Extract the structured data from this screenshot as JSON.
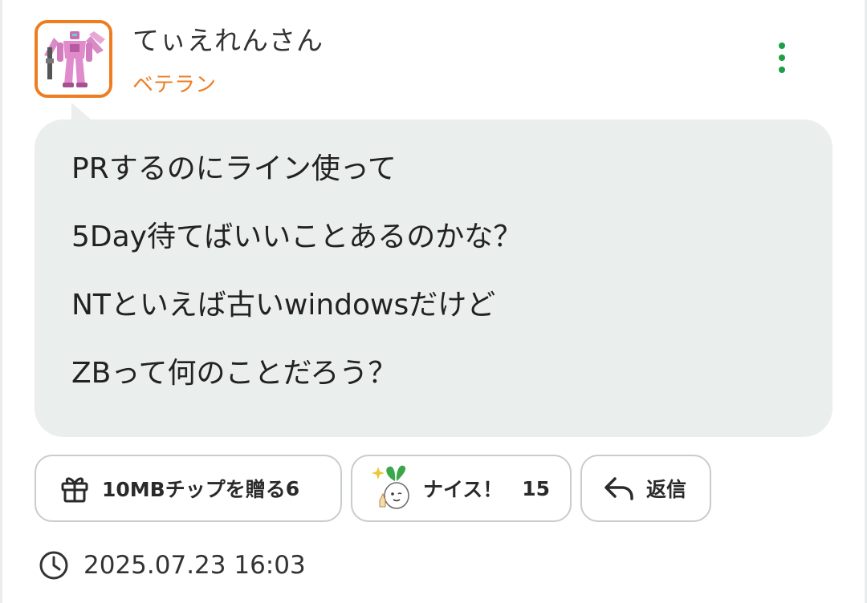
{
  "post": {
    "user": {
      "name": "てぃえれんさん",
      "rank": "ベテラン",
      "rank_color": "#ee7d22",
      "avatar_icon": "robot-mecha-avatar"
    },
    "menu_icon": "more-vertical-icon",
    "message_lines": [
      "PRするのにライン使って",
      "5Day待てばいいことあるのかな？",
      "NTといえば古いwindowsだけど",
      "ZBって何のことだろう？"
    ],
    "actions": {
      "gift": {
        "icon": "gift-icon",
        "label": "10MBチップを贈る",
        "count": "6"
      },
      "nice": {
        "icon": "sprout-mascot-icon",
        "label": "ナイス！",
        "count": "15"
      },
      "reply": {
        "icon": "reply-arrow-icon",
        "label": "返信"
      }
    },
    "timestamp": {
      "icon": "clock-icon",
      "value": "2025.07.23 16:03"
    }
  },
  "colors": {
    "accent_orange": "#ee7d22",
    "menu_green": "#1e9e47",
    "bubble_bg": "#eaeeec",
    "button_border": "#c8cccc"
  }
}
